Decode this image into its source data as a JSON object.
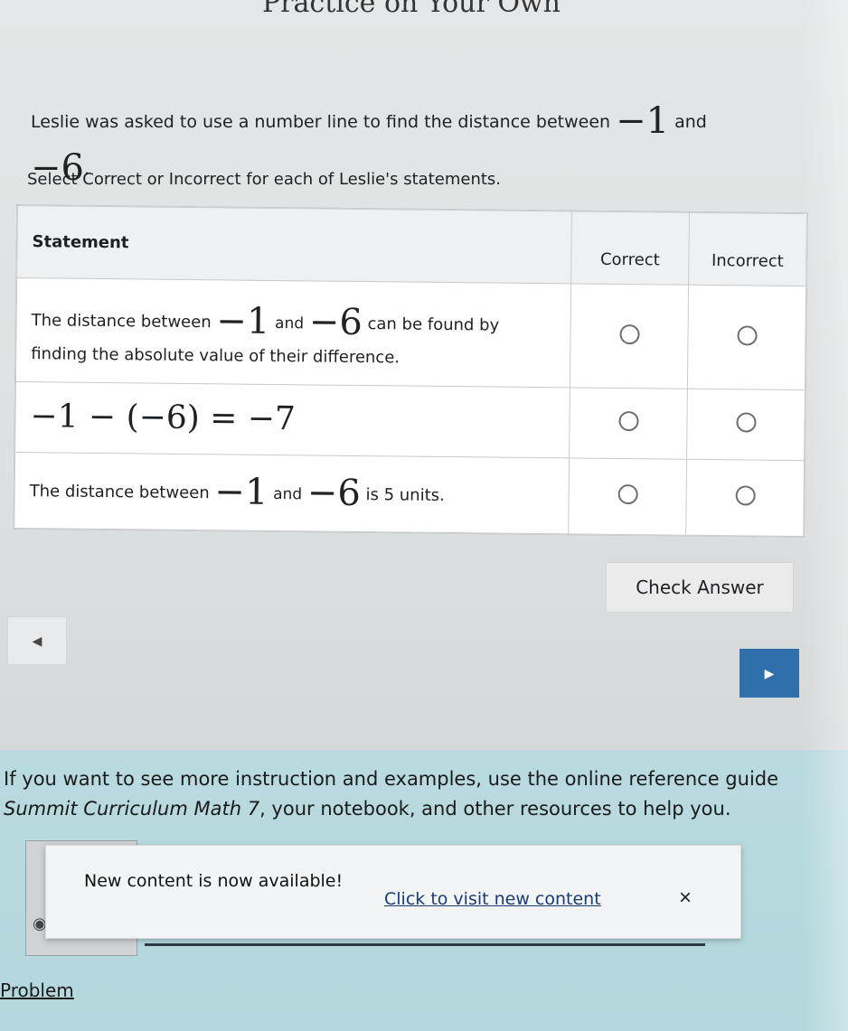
{
  "page": {
    "heading": "Practice on Your Own",
    "question": {
      "prefix": "Leslie was asked to use a number line to find the distance between",
      "value_a": "−1",
      "connector": "and",
      "value_b": "−6",
      "end": "."
    },
    "instructions": "Select Correct or Incorrect for each of Leslie's statements."
  },
  "table": {
    "headers": {
      "statement": "Statement",
      "correct": "Correct",
      "incorrect": "Incorrect"
    },
    "rows": [
      {
        "part1": "The distance between",
        "a": "−1",
        "and": "and",
        "b": "−6",
        "part2": "can be found by finding the absolute value of their difference."
      },
      {
        "equation": "−1 − (−6) = −7"
      },
      {
        "part1": "The distance between",
        "a": "−1",
        "and": "and",
        "b": "−6",
        "part2": "is 5 units."
      }
    ]
  },
  "buttons": {
    "check": "Check Answer",
    "prev_icon": "chevron-left-icon",
    "next_icon": "chevron-right-icon"
  },
  "help": {
    "line1": "If you want to see more instruction and examples, use the online reference guide",
    "line2_course": "Summit Curriculum Math 7",
    "line2_rest": ", your notebook, and other resources to help you."
  },
  "toast": {
    "message": "New content is now available!",
    "link": "Click to visit new content",
    "close": "×"
  },
  "footer": {
    "problem_link": "Problem"
  },
  "colors": {
    "next_button": "#2f6fab",
    "bottom_panel": "#b9dbe0",
    "link": "#1a3c73"
  }
}
